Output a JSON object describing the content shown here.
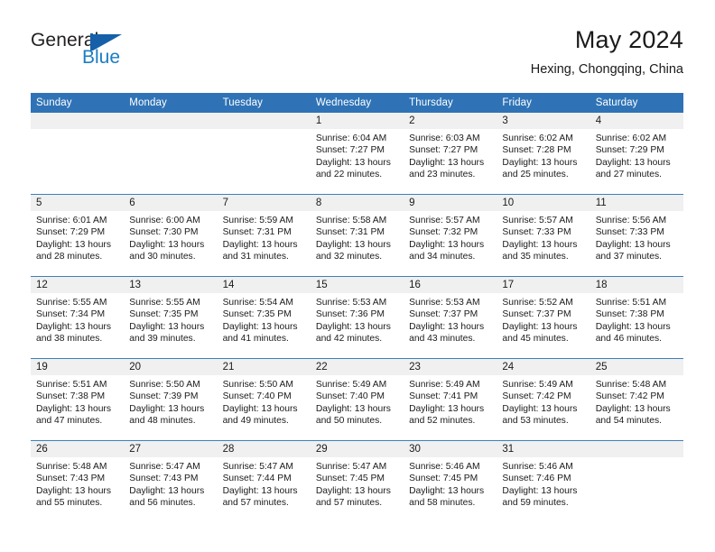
{
  "logo": {
    "word_top": "General",
    "word_bottom": "Blue",
    "triangle_color": "#1560a8",
    "blue_text_color": "#1a7dc4"
  },
  "header": {
    "title": "May 2024",
    "location": "Hexing, Chongqing, China"
  },
  "theme": {
    "header_blue": "#2f73b6",
    "row_separator_blue": "#3f7fbe",
    "daynum_band_gray": "#f0f0f0",
    "text_color": "#1a1a1a"
  },
  "weekday_headers": [
    "Sunday",
    "Monday",
    "Tuesday",
    "Wednesday",
    "Thursday",
    "Friday",
    "Saturday"
  ],
  "weeks": [
    [
      {
        "day": "",
        "blank": true,
        "sunrise": "",
        "sunset": "",
        "daylight_line1": "",
        "daylight_line2": ""
      },
      {
        "day": "",
        "blank": true,
        "sunrise": "",
        "sunset": "",
        "daylight_line1": "",
        "daylight_line2": ""
      },
      {
        "day": "",
        "blank": true,
        "sunrise": "",
        "sunset": "",
        "daylight_line1": "",
        "daylight_line2": ""
      },
      {
        "day": "1",
        "blank": false,
        "sunrise": "Sunrise: 6:04 AM",
        "sunset": "Sunset: 7:27 PM",
        "daylight_line1": "Daylight: 13 hours",
        "daylight_line2": "and 22 minutes."
      },
      {
        "day": "2",
        "blank": false,
        "sunrise": "Sunrise: 6:03 AM",
        "sunset": "Sunset: 7:27 PM",
        "daylight_line1": "Daylight: 13 hours",
        "daylight_line2": "and 23 minutes."
      },
      {
        "day": "3",
        "blank": false,
        "sunrise": "Sunrise: 6:02 AM",
        "sunset": "Sunset: 7:28 PM",
        "daylight_line1": "Daylight: 13 hours",
        "daylight_line2": "and 25 minutes."
      },
      {
        "day": "4",
        "blank": false,
        "sunrise": "Sunrise: 6:02 AM",
        "sunset": "Sunset: 7:29 PM",
        "daylight_line1": "Daylight: 13 hours",
        "daylight_line2": "and 27 minutes."
      }
    ],
    [
      {
        "day": "5",
        "blank": false,
        "sunrise": "Sunrise: 6:01 AM",
        "sunset": "Sunset: 7:29 PM",
        "daylight_line1": "Daylight: 13 hours",
        "daylight_line2": "and 28 minutes."
      },
      {
        "day": "6",
        "blank": false,
        "sunrise": "Sunrise: 6:00 AM",
        "sunset": "Sunset: 7:30 PM",
        "daylight_line1": "Daylight: 13 hours",
        "daylight_line2": "and 30 minutes."
      },
      {
        "day": "7",
        "blank": false,
        "sunrise": "Sunrise: 5:59 AM",
        "sunset": "Sunset: 7:31 PM",
        "daylight_line1": "Daylight: 13 hours",
        "daylight_line2": "and 31 minutes."
      },
      {
        "day": "8",
        "blank": false,
        "sunrise": "Sunrise: 5:58 AM",
        "sunset": "Sunset: 7:31 PM",
        "daylight_line1": "Daylight: 13 hours",
        "daylight_line2": "and 32 minutes."
      },
      {
        "day": "9",
        "blank": false,
        "sunrise": "Sunrise: 5:57 AM",
        "sunset": "Sunset: 7:32 PM",
        "daylight_line1": "Daylight: 13 hours",
        "daylight_line2": "and 34 minutes."
      },
      {
        "day": "10",
        "blank": false,
        "sunrise": "Sunrise: 5:57 AM",
        "sunset": "Sunset: 7:33 PM",
        "daylight_line1": "Daylight: 13 hours",
        "daylight_line2": "and 35 minutes."
      },
      {
        "day": "11",
        "blank": false,
        "sunrise": "Sunrise: 5:56 AM",
        "sunset": "Sunset: 7:33 PM",
        "daylight_line1": "Daylight: 13 hours",
        "daylight_line2": "and 37 minutes."
      }
    ],
    [
      {
        "day": "12",
        "blank": false,
        "sunrise": "Sunrise: 5:55 AM",
        "sunset": "Sunset: 7:34 PM",
        "daylight_line1": "Daylight: 13 hours",
        "daylight_line2": "and 38 minutes."
      },
      {
        "day": "13",
        "blank": false,
        "sunrise": "Sunrise: 5:55 AM",
        "sunset": "Sunset: 7:35 PM",
        "daylight_line1": "Daylight: 13 hours",
        "daylight_line2": "and 39 minutes."
      },
      {
        "day": "14",
        "blank": false,
        "sunrise": "Sunrise: 5:54 AM",
        "sunset": "Sunset: 7:35 PM",
        "daylight_line1": "Daylight: 13 hours",
        "daylight_line2": "and 41 minutes."
      },
      {
        "day": "15",
        "blank": false,
        "sunrise": "Sunrise: 5:53 AM",
        "sunset": "Sunset: 7:36 PM",
        "daylight_line1": "Daylight: 13 hours",
        "daylight_line2": "and 42 minutes."
      },
      {
        "day": "16",
        "blank": false,
        "sunrise": "Sunrise: 5:53 AM",
        "sunset": "Sunset: 7:37 PM",
        "daylight_line1": "Daylight: 13 hours",
        "daylight_line2": "and 43 minutes."
      },
      {
        "day": "17",
        "blank": false,
        "sunrise": "Sunrise: 5:52 AM",
        "sunset": "Sunset: 7:37 PM",
        "daylight_line1": "Daylight: 13 hours",
        "daylight_line2": "and 45 minutes."
      },
      {
        "day": "18",
        "blank": false,
        "sunrise": "Sunrise: 5:51 AM",
        "sunset": "Sunset: 7:38 PM",
        "daylight_line1": "Daylight: 13 hours",
        "daylight_line2": "and 46 minutes."
      }
    ],
    [
      {
        "day": "19",
        "blank": false,
        "sunrise": "Sunrise: 5:51 AM",
        "sunset": "Sunset: 7:38 PM",
        "daylight_line1": "Daylight: 13 hours",
        "daylight_line2": "and 47 minutes."
      },
      {
        "day": "20",
        "blank": false,
        "sunrise": "Sunrise: 5:50 AM",
        "sunset": "Sunset: 7:39 PM",
        "daylight_line1": "Daylight: 13 hours",
        "daylight_line2": "and 48 minutes."
      },
      {
        "day": "21",
        "blank": false,
        "sunrise": "Sunrise: 5:50 AM",
        "sunset": "Sunset: 7:40 PM",
        "daylight_line1": "Daylight: 13 hours",
        "daylight_line2": "and 49 minutes."
      },
      {
        "day": "22",
        "blank": false,
        "sunrise": "Sunrise: 5:49 AM",
        "sunset": "Sunset: 7:40 PM",
        "daylight_line1": "Daylight: 13 hours",
        "daylight_line2": "and 50 minutes."
      },
      {
        "day": "23",
        "blank": false,
        "sunrise": "Sunrise: 5:49 AM",
        "sunset": "Sunset: 7:41 PM",
        "daylight_line1": "Daylight: 13 hours",
        "daylight_line2": "and 52 minutes."
      },
      {
        "day": "24",
        "blank": false,
        "sunrise": "Sunrise: 5:49 AM",
        "sunset": "Sunset: 7:42 PM",
        "daylight_line1": "Daylight: 13 hours",
        "daylight_line2": "and 53 minutes."
      },
      {
        "day": "25",
        "blank": false,
        "sunrise": "Sunrise: 5:48 AM",
        "sunset": "Sunset: 7:42 PM",
        "daylight_line1": "Daylight: 13 hours",
        "daylight_line2": "and 54 minutes."
      }
    ],
    [
      {
        "day": "26",
        "blank": false,
        "sunrise": "Sunrise: 5:48 AM",
        "sunset": "Sunset: 7:43 PM",
        "daylight_line1": "Daylight: 13 hours",
        "daylight_line2": "and 55 minutes."
      },
      {
        "day": "27",
        "blank": false,
        "sunrise": "Sunrise: 5:47 AM",
        "sunset": "Sunset: 7:43 PM",
        "daylight_line1": "Daylight: 13 hours",
        "daylight_line2": "and 56 minutes."
      },
      {
        "day": "28",
        "blank": false,
        "sunrise": "Sunrise: 5:47 AM",
        "sunset": "Sunset: 7:44 PM",
        "daylight_line1": "Daylight: 13 hours",
        "daylight_line2": "and 57 minutes."
      },
      {
        "day": "29",
        "blank": false,
        "sunrise": "Sunrise: 5:47 AM",
        "sunset": "Sunset: 7:45 PM",
        "daylight_line1": "Daylight: 13 hours",
        "daylight_line2": "and 57 minutes."
      },
      {
        "day": "30",
        "blank": false,
        "sunrise": "Sunrise: 5:46 AM",
        "sunset": "Sunset: 7:45 PM",
        "daylight_line1": "Daylight: 13 hours",
        "daylight_line2": "and 58 minutes."
      },
      {
        "day": "31",
        "blank": false,
        "sunrise": "Sunrise: 5:46 AM",
        "sunset": "Sunset: 7:46 PM",
        "daylight_line1": "Daylight: 13 hours",
        "daylight_line2": "and 59 minutes."
      },
      {
        "day": "",
        "blank": true,
        "sunrise": "",
        "sunset": "",
        "daylight_line1": "",
        "daylight_line2": ""
      }
    ]
  ]
}
